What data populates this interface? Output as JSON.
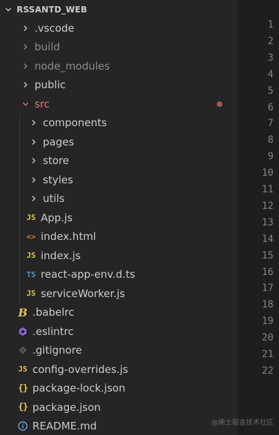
{
  "explorer": {
    "root": "RSSANTD_WEB",
    "items": [
      {
        "label": ".vscode",
        "type": "folder",
        "state": "collapsed",
        "depth": 0
      },
      {
        "label": "build",
        "type": "folder",
        "state": "collapsed",
        "depth": 0,
        "dim": true
      },
      {
        "label": "node_modules",
        "type": "folder",
        "state": "collapsed",
        "depth": 0,
        "dim": true
      },
      {
        "label": "public",
        "type": "folder",
        "state": "collapsed",
        "depth": 0
      },
      {
        "label": "src",
        "type": "folder",
        "state": "expanded",
        "depth": 0,
        "modified": true
      },
      {
        "label": "components",
        "type": "folder",
        "state": "collapsed",
        "depth": 1
      },
      {
        "label": "pages",
        "type": "folder",
        "state": "collapsed",
        "depth": 1
      },
      {
        "label": "store",
        "type": "folder",
        "state": "collapsed",
        "depth": 1
      },
      {
        "label": "styles",
        "type": "folder",
        "state": "collapsed",
        "depth": 1
      },
      {
        "label": "utils",
        "type": "folder",
        "state": "collapsed",
        "depth": 1
      },
      {
        "label": "App.js",
        "type": "file",
        "icon": "js",
        "icon_text": "JS",
        "depth": 1
      },
      {
        "label": "index.html",
        "type": "file",
        "icon": "html",
        "icon_text": "<>",
        "depth": 1
      },
      {
        "label": "index.js",
        "type": "file",
        "icon": "js",
        "icon_text": "JS",
        "depth": 1
      },
      {
        "label": "react-app-env.d.ts",
        "type": "file",
        "icon": "ts",
        "icon_text": "TS",
        "depth": 1
      },
      {
        "label": "serviceWorker.js",
        "type": "file",
        "icon": "js",
        "icon_text": "JS",
        "depth": 1
      },
      {
        "label": ".babelrc",
        "type": "file",
        "icon": "babel",
        "icon_text": "B",
        "depth": 0
      },
      {
        "label": ".eslintrc",
        "type": "file",
        "icon": "eslint",
        "icon_text": "",
        "depth": 0
      },
      {
        "label": ".gitignore",
        "type": "file",
        "icon": "git",
        "icon_text": "",
        "depth": 0
      },
      {
        "label": "config-overrides.js",
        "type": "file",
        "icon": "js",
        "icon_text": "JS",
        "depth": 0
      },
      {
        "label": "package-lock.json",
        "type": "file",
        "icon": "json",
        "icon_text": "{}",
        "depth": 0
      },
      {
        "label": "package.json",
        "type": "file",
        "icon": "json",
        "icon_text": "{}",
        "depth": 0
      },
      {
        "label": "README.md",
        "type": "file",
        "icon": "info",
        "icon_text": "ⓘ",
        "depth": 0
      }
    ]
  },
  "editor": {
    "line_numbers": [
      "1",
      "2",
      "3",
      "4",
      "5",
      "6",
      "7",
      "8",
      "9",
      "10",
      "11",
      "12",
      "13",
      "14",
      "15",
      "16",
      "17",
      "18",
      "19",
      "20",
      "21",
      "22"
    ]
  },
  "watermark": "@稀土掘金技术社区",
  "colors": {
    "sidebar_bg": "#252526",
    "editor_bg": "#1e1e1e",
    "text": "#cccccc",
    "dim_text": "#8c8c8c",
    "modified": "#e2766b",
    "js_icon": "#e5c453",
    "ts_icon": "#519aba",
    "html_icon": "#e37933"
  }
}
